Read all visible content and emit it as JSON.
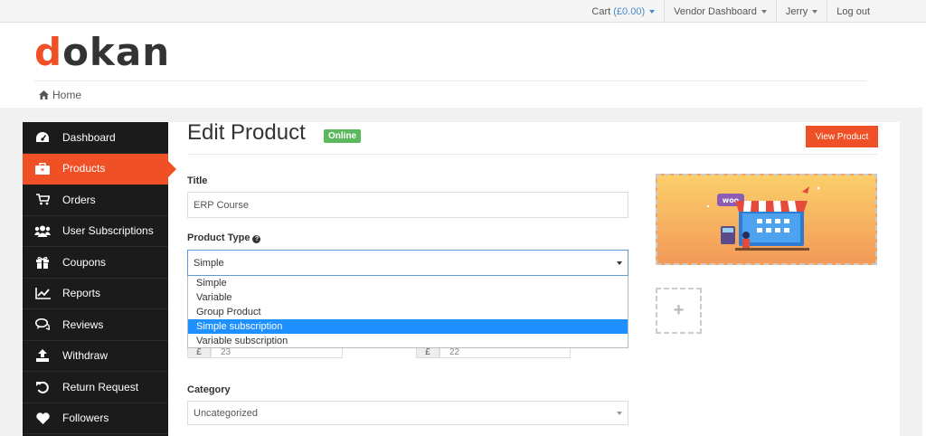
{
  "topnav": {
    "cart_label": "Cart",
    "cart_amount": "(£0.00)",
    "vendor_dashboard": "Vendor Dashboard",
    "user": "Jerry",
    "logout": "Log out"
  },
  "brand": {
    "logo_first": "d",
    "logo_rest": "okan",
    "accent": "#f05025"
  },
  "breadcrumb": {
    "home": "Home"
  },
  "sidebar": {
    "items": [
      {
        "label": "Dashboard",
        "icon": "dashboard-icon"
      },
      {
        "label": "Products",
        "icon": "briefcase-icon",
        "active": true
      },
      {
        "label": "Orders",
        "icon": "cart-icon"
      },
      {
        "label": "User Subscriptions",
        "icon": "users-icon"
      },
      {
        "label": "Coupons",
        "icon": "gift-icon"
      },
      {
        "label": "Reports",
        "icon": "chart-icon"
      },
      {
        "label": "Reviews",
        "icon": "comments-icon"
      },
      {
        "label": "Withdraw",
        "icon": "upload-icon"
      },
      {
        "label": "Return Request",
        "icon": "undo-icon"
      },
      {
        "label": "Followers",
        "icon": "heart-icon"
      }
    ]
  },
  "page": {
    "title": "Edit Product",
    "status_badge": "Online",
    "view_button": "View Product"
  },
  "form": {
    "title_label": "Title",
    "title_value": "ERP Course",
    "product_type_label": "Product Type",
    "product_type_value": "Simple",
    "product_type_options": [
      "Simple",
      "Variable",
      "Group Product",
      "Simple subscription",
      "Variable subscription"
    ],
    "highlighted_option": 3,
    "price_currency": "£",
    "regular_price_value": "23",
    "discount_price_value": "22",
    "category_label": "Category",
    "category_value": "Uncategorized"
  },
  "colors": {
    "sidebar_bg": "#1b1b1b",
    "online": "#5cb85c",
    "dropdown_highlight": "#1e90ff"
  }
}
